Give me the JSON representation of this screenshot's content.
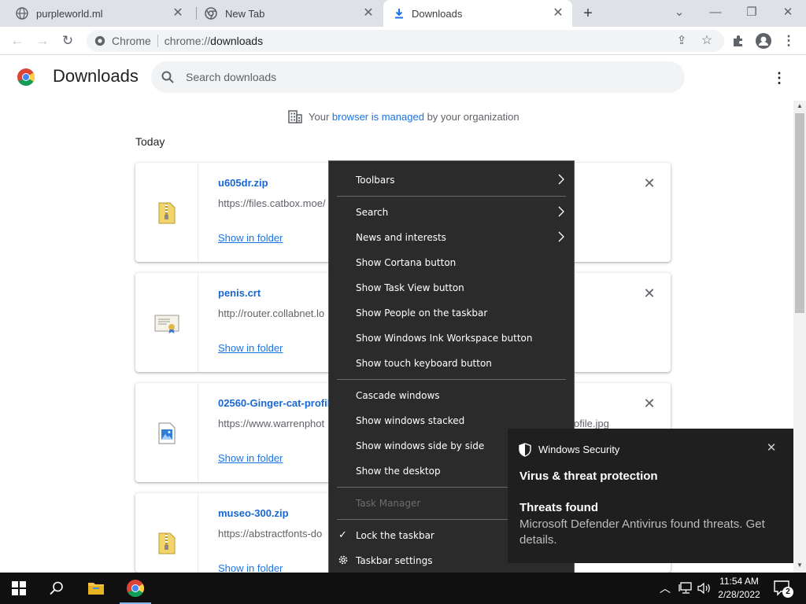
{
  "browser": {
    "tabs": [
      {
        "title": "purpleworld.ml",
        "icon": "globe-icon"
      },
      {
        "title": "New Tab",
        "icon": "chrome-icon"
      },
      {
        "title": "Downloads",
        "icon": "download-icon",
        "active": true
      }
    ],
    "new_tab_label": "+",
    "omnibox": {
      "origin": "Chrome",
      "scheme": "chrome://",
      "path": "downloads"
    }
  },
  "downloads": {
    "title": "Downloads",
    "search_placeholder": "Search downloads",
    "managed_prefix": "Your ",
    "managed_link": "browser is managed",
    "managed_suffix": " by your organization",
    "date_header": "Today",
    "items": [
      {
        "name": "u605dr.zip",
        "url": "https://files.catbox.moe/",
        "action": "Show in folder",
        "type": "zip-file-icon"
      },
      {
        "name": "penis.crt",
        "url": "http://router.collabnet.lo",
        "action": "Show in folder",
        "type": "certificate-icon"
      },
      {
        "name": "02560-Ginger-cat-profile",
        "url": "https://www.warrenphot",
        "url_tail": "ofile.jpg",
        "action": "Show in folder",
        "type": "image-file-icon"
      },
      {
        "name": "museo-300.zip",
        "url": "https://abstractfonts-do",
        "action": "Show in folder",
        "type": "zip-file-icon"
      }
    ]
  },
  "context_menu": {
    "items": [
      {
        "label": "Toolbars",
        "submenu": true
      },
      {
        "label": "Search",
        "submenu": true
      },
      {
        "label": "News and interests",
        "submenu": true
      },
      {
        "label": "Show Cortana button"
      },
      {
        "label": "Show Task View button"
      },
      {
        "label": "Show People on the taskbar"
      },
      {
        "label": "Show Windows Ink Workspace button"
      },
      {
        "label": "Show touch keyboard button"
      },
      {
        "label": "Cascade windows"
      },
      {
        "label": "Show windows stacked"
      },
      {
        "label": "Show windows side by side"
      },
      {
        "label": "Show the desktop"
      },
      {
        "label": "Task Manager",
        "disabled": true
      },
      {
        "label": "Lock the taskbar",
        "checked": true
      },
      {
        "label": "Taskbar settings",
        "icon": "gear-icon"
      }
    ]
  },
  "notification": {
    "app": "Windows Security",
    "title": "Virus & threat protection",
    "heading": "Threats found",
    "body": "Microsoft Defender Antivirus found threats. Get details."
  },
  "taskbar": {
    "time": "11:54 AM",
    "date": "2/28/2022",
    "notification_count": "2",
    "accent": "#7eb4ea"
  }
}
